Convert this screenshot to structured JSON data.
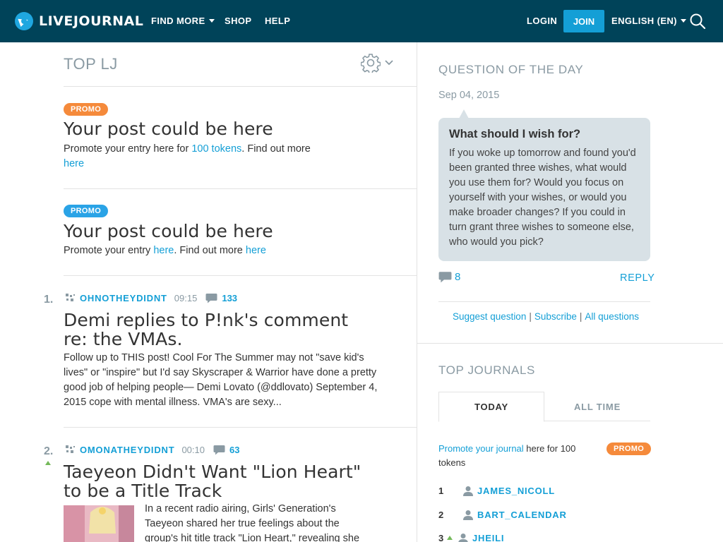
{
  "header": {
    "logo_text": "LIVEJOURNAL",
    "nav": {
      "find_more": "FIND MORE",
      "shop": "SHOP",
      "help": "HELP"
    },
    "login": "LOGIN",
    "join": "JOIN",
    "language": "ENGLISH (EN)"
  },
  "top_lj": {
    "title": "TOP LJ",
    "promos": [
      {
        "badge": "PROMO",
        "title": "Your post could be here",
        "text_before": "Promote your entry here for ",
        "link1": "100 tokens",
        "text_mid": ". Find out more",
        "link2": "here"
      },
      {
        "badge": "PROMO",
        "title": "Your post could be here",
        "text_before": "Promote your entry ",
        "link1": "here",
        "text_mid": ". Find out more ",
        "link2": "here"
      }
    ],
    "posts": [
      {
        "rank": "1.",
        "author": "OHNOTHEYDIDNT",
        "time": "09:15",
        "comments": "133",
        "title": "Demi replies to P!nk's comment re: the VMAs.",
        "excerpt": "Follow up to THIS post! Cool For The Summer may not \"save kid's lives\" or \"inspire\" but I'd say Skyscraper & Warrior have done a pretty good job of helping people— Demi Lovato (@ddlovato) September 4, 2015 cope with mental illness. VMA's are sexy..."
      },
      {
        "rank": "2.",
        "author": "OMONATHEYDIDNT",
        "time": "00:10",
        "comments": "63",
        "title": "Taeyeon Didn't Want \"Lion Heart\" to be a Title Track",
        "excerpt": "In a recent radio airing, Girls' Generation's Taeyeon shared her true feelings about the group's hit title track \"Lion Heart,\" revealing she"
      }
    ]
  },
  "qotd": {
    "title": "QUESTION OF THE DAY",
    "date": "Sep 04, 2015",
    "question": "What should I wish for?",
    "body": "If you woke up tomorrow and found you'd been granted three wishes, what would you use them for? Would you focus on yourself with your wishes, or would you make broader changes? If you could in turn grant three wishes to someone else, who would you pick?",
    "comment_count": "8",
    "reply": "REPLY",
    "links": {
      "suggest": "Suggest question",
      "subscribe": "Subscribe",
      "all": "All questions"
    }
  },
  "top_journals": {
    "title": "TOP JOURNALS",
    "tabs": {
      "today": "TODAY",
      "all_time": "ALL TIME"
    },
    "promo_link": "Promote your journal",
    "promo_rest": " here for 100 tokens",
    "promo_badge": "PROMO",
    "rows": [
      {
        "num": "1",
        "name": "JAMES_NICOLL"
      },
      {
        "num": "2",
        "name": "BART_CALENDAR"
      },
      {
        "num": "3",
        "name": "JHEILI"
      }
    ]
  },
  "colors": {
    "header_bg": "#004359",
    "accent": "#149fd6",
    "promo_orange": "#f58a3b",
    "promo_blue": "#2aa3e6"
  }
}
